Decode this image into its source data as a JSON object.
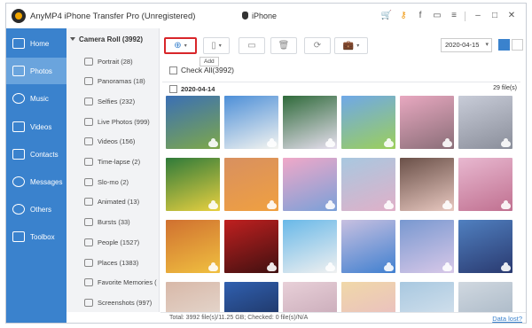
{
  "app": {
    "title": "AnyMP4 iPhone Transfer Pro (Unregistered)",
    "device": "iPhone",
    "title_icons": [
      "cart-icon",
      "key-icon",
      "facebook-icon",
      "chat-icon",
      "menu-icon",
      "minimize-icon",
      "maximize-icon",
      "close-icon"
    ],
    "accent": "#3a82cd"
  },
  "nav": {
    "items": [
      {
        "label": "Home",
        "icon": "home-icon"
      },
      {
        "label": "Photos",
        "icon": "photo-icon",
        "active": true
      },
      {
        "label": "Music",
        "icon": "music-icon"
      },
      {
        "label": "Videos",
        "icon": "video-icon"
      },
      {
        "label": "Contacts",
        "icon": "contacts-icon"
      },
      {
        "label": "Messages",
        "icon": "messages-icon"
      },
      {
        "label": "Others",
        "icon": "others-icon"
      },
      {
        "label": "Toolbox",
        "icon": "toolbox-icon"
      }
    ]
  },
  "albums": {
    "header": "Camera Roll (3992)",
    "items": [
      "Portrait (28)",
      "Panoramas (18)",
      "Selfies (232)",
      "Live Photos (999)",
      "Videos (156)",
      "Time-lapse (2)",
      "Slo-mo (2)",
      "Animated (13)",
      "Bursts (33)",
      "People (1527)",
      "Places (1383)",
      "Favorite Memories (",
      "Screenshots (997)"
    ]
  },
  "toolbar": {
    "add_tooltip": "Add",
    "date_value": "2020-04-15"
  },
  "content": {
    "check_all": "Check All(3992)",
    "group_date": "2020-04-14",
    "group_count": "29 file(s)",
    "photos": [
      {
        "colors": [
          "#3a6fb5",
          "#7ea84a"
        ]
      },
      {
        "colors": [
          "#4d8fd8",
          "#f4f4f0"
        ]
      },
      {
        "colors": [
          "#2f6a3a",
          "#e8e0f0"
        ]
      },
      {
        "colors": [
          "#6fa8e8",
          "#9ccf5a"
        ]
      },
      {
        "colors": [
          "#e8a8c0",
          "#8a6e78"
        ]
      },
      {
        "colors": [
          "#c8ccd8",
          "#8a8e9a"
        ]
      },
      {
        "colors": [
          "#2f7a3a",
          "#e8d040"
        ]
      },
      {
        "colors": [
          "#d89060",
          "#f0a040"
        ]
      },
      {
        "colors": [
          "#f0a8c8",
          "#7aa0d8"
        ]
      },
      {
        "colors": [
          "#a8c8e0",
          "#e0b0c8"
        ]
      },
      {
        "colors": [
          "#6a5048",
          "#e8c8c0"
        ]
      },
      {
        "colors": [
          "#e8b8d0",
          "#c07090"
        ]
      },
      {
        "colors": [
          "#d07030",
          "#f0c040"
        ]
      },
      {
        "colors": [
          "#c02020",
          "#401010"
        ]
      },
      {
        "colors": [
          "#68b8e8",
          "#f0f0f0"
        ]
      },
      {
        "colors": [
          "#c8c0e0",
          "#4080d0"
        ]
      },
      {
        "colors": [
          "#7898d0",
          "#d8c8e8"
        ]
      },
      {
        "colors": [
          "#5080c0",
          "#2a3a70"
        ]
      },
      {
        "colors": [
          "#d8b8a8",
          "#e8e0d8"
        ]
      },
      {
        "colors": [
          "#3060b0",
          "#1a2a50"
        ]
      },
      {
        "colors": [
          "#e8d0d8",
          "#c0a0b0"
        ]
      },
      {
        "colors": [
          "#f0d8a8",
          "#e8b8c8"
        ]
      },
      {
        "colors": [
          "#a8c8e0",
          "#e0e8f0"
        ]
      },
      {
        "colors": [
          "#d0d8e0",
          "#a0b0c0"
        ]
      }
    ]
  },
  "status": {
    "text": "Total: 3992 file(s)/11.25 GB; Checked: 0 file(s)/N/A",
    "data_lost": "Data lost?"
  }
}
